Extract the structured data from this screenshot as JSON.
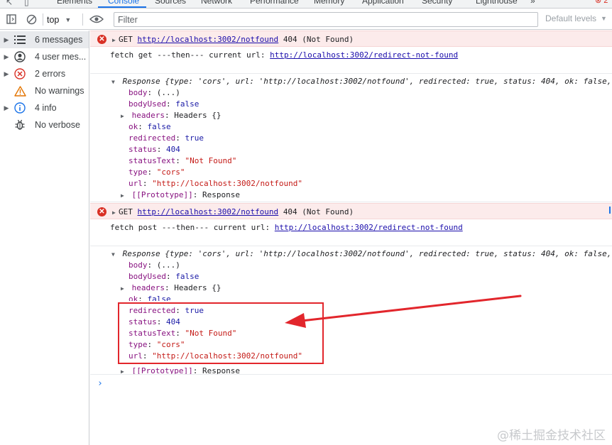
{
  "tabs": [
    {
      "label": "Elements",
      "active": false
    },
    {
      "label": "Console",
      "active": true
    },
    {
      "label": "Sources",
      "active": false
    },
    {
      "label": "Network",
      "active": false
    },
    {
      "label": "Performance",
      "active": false
    },
    {
      "label": "Memory",
      "active": false
    },
    {
      "label": "Application",
      "active": false
    },
    {
      "label": "Security",
      "active": false
    },
    {
      "label": "Lighthouse",
      "active": false
    }
  ],
  "tab_overflow": "»",
  "error_badge_count": "2",
  "toolbar": {
    "context": "top",
    "filter_placeholder": "Filter",
    "levels_label": "Default levels"
  },
  "sidebar": {
    "items": [
      {
        "label": "6 messages",
        "icon": "list-icon",
        "expandable": true,
        "selected": true
      },
      {
        "label": "4 user mes...",
        "icon": "user-icon",
        "expandable": true,
        "selected": false
      },
      {
        "label": "2 errors",
        "icon": "error-icon",
        "expandable": true,
        "selected": false
      },
      {
        "label": "No warnings",
        "icon": "warning-icon",
        "expandable": false,
        "selected": false
      },
      {
        "label": "4 info",
        "icon": "info-icon",
        "expandable": true,
        "selected": false
      },
      {
        "label": "No verbose",
        "icon": "bug-icon",
        "expandable": false,
        "selected": false
      }
    ]
  },
  "console": {
    "error1": {
      "method": "GET",
      "url": "http://localhost:3002/notfound",
      "status": "404 (Not Found)"
    },
    "log1": {
      "prefix": "fetch get ---then--- current url:",
      "url": "http://localhost:3002/redirect-not-found"
    },
    "object1": {
      "summary": "Response {type: 'cors', url: 'http://localhost:3002/notfound', redirected: true, status: 404, ok: false,",
      "props": [
        {
          "key": "body",
          "value": "(...)",
          "kind": "plain",
          "expandable": false
        },
        {
          "key": "bodyUsed",
          "value": "false",
          "kind": "kw",
          "expandable": false
        },
        {
          "key": "headers",
          "value": "Headers {}",
          "kind": "plain",
          "expandable": true
        },
        {
          "key": "ok",
          "value": "false",
          "kind": "kw",
          "expandable": false
        },
        {
          "key": "redirected",
          "value": "true",
          "kind": "kw",
          "expandable": false
        },
        {
          "key": "status",
          "value": "404",
          "kind": "num",
          "expandable": false
        },
        {
          "key": "statusText",
          "value": "\"Not Found\"",
          "kind": "str",
          "expandable": false
        },
        {
          "key": "type",
          "value": "\"cors\"",
          "kind": "str",
          "expandable": false
        },
        {
          "key": "url",
          "value": "\"http://localhost:3002/notfound\"",
          "kind": "str",
          "expandable": false
        },
        {
          "key": "[[Prototype]]",
          "value": "Response",
          "kind": "plain",
          "expandable": true
        }
      ]
    },
    "error2": {
      "method": "GET",
      "url": "http://localhost:3002/notfound",
      "status": "404 (Not Found)"
    },
    "log2": {
      "prefix": "fetch post ---then--- current url:",
      "url": "http://localhost:3002/redirect-not-found"
    },
    "object2": {
      "summary": "Response {type: 'cors', url: 'http://localhost:3002/notfound', redirected: true, status: 404, ok: false,",
      "props": [
        {
          "key": "body",
          "value": "(...)",
          "kind": "plain",
          "expandable": false
        },
        {
          "key": "bodyUsed",
          "value": "false",
          "kind": "kw",
          "expandable": false
        },
        {
          "key": "headers",
          "value": "Headers {}",
          "kind": "plain",
          "expandable": true
        },
        {
          "key": "ok",
          "value": "false",
          "kind": "kw",
          "expandable": false
        },
        {
          "key": "redirected",
          "value": "true",
          "kind": "kw",
          "expandable": false
        },
        {
          "key": "status",
          "value": "404",
          "kind": "num",
          "expandable": false
        },
        {
          "key": "statusText",
          "value": "\"Not Found\"",
          "kind": "str",
          "expandable": false
        },
        {
          "key": "type",
          "value": "\"cors\"",
          "kind": "str",
          "expandable": false
        },
        {
          "key": "url",
          "value": "\"http://localhost:3002/notfound\"",
          "kind": "str",
          "expandable": false
        },
        {
          "key": "[[Prototype]]",
          "value": "Response",
          "kind": "plain",
          "expandable": true
        }
      ]
    },
    "prompt": "›"
  },
  "annotation_color": "#e2262c",
  "watermark": "@稀土掘金技术社区"
}
